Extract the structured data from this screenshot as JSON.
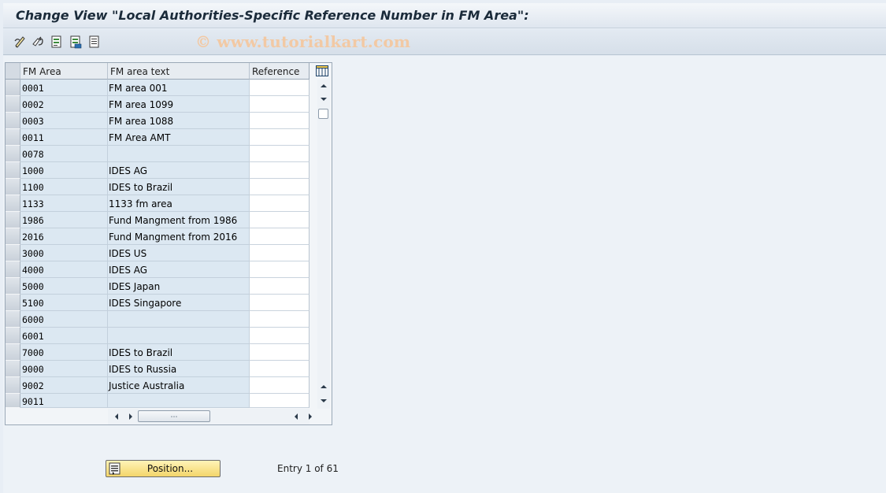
{
  "window": {
    "title": "Change View \"Local Authorities-Specific Reference Number in FM Area\":"
  },
  "toolbar": {
    "watermark": "© www.tutorialkart.com",
    "icons": [
      "display-change-icon",
      "undo-changes-icon",
      "new-entries-icon",
      "copy-as-icon",
      "delete-icon"
    ]
  },
  "table": {
    "columns": [
      "FM Area",
      "FM area text",
      "Reference"
    ],
    "rows": [
      {
        "fm_area": "0001",
        "text": "FM area 001",
        "reference": ""
      },
      {
        "fm_area": "0002",
        "text": "FM area 1099",
        "reference": ""
      },
      {
        "fm_area": "0003",
        "text": "FM area 1088",
        "reference": ""
      },
      {
        "fm_area": "0011",
        "text": "FM Area AMT",
        "reference": ""
      },
      {
        "fm_area": "0078",
        "text": "",
        "reference": ""
      },
      {
        "fm_area": "1000",
        "text": "IDES AG",
        "reference": ""
      },
      {
        "fm_area": "1100",
        "text": "IDES to Brazil",
        "reference": ""
      },
      {
        "fm_area": "1133",
        "text": "1133 fm area",
        "reference": ""
      },
      {
        "fm_area": "1986",
        "text": "Fund Mangment from 1986",
        "reference": ""
      },
      {
        "fm_area": "2016",
        "text": "Fund Mangment from 2016",
        "reference": ""
      },
      {
        "fm_area": "3000",
        "text": "IDES US",
        "reference": ""
      },
      {
        "fm_area": "4000",
        "text": "IDES AG",
        "reference": ""
      },
      {
        "fm_area": "5000",
        "text": "IDES Japan",
        "reference": ""
      },
      {
        "fm_area": "5100",
        "text": "IDES Singapore",
        "reference": ""
      },
      {
        "fm_area": "6000",
        "text": "",
        "reference": ""
      },
      {
        "fm_area": "6001",
        "text": "",
        "reference": ""
      },
      {
        "fm_area": "7000",
        "text": "IDES to Brazil",
        "reference": ""
      },
      {
        "fm_area": "9000",
        "text": "IDES to Russia",
        "reference": ""
      },
      {
        "fm_area": "9002",
        "text": "Justice Australia",
        "reference": ""
      },
      {
        "fm_area": "9011",
        "text": "",
        "reference": ""
      }
    ]
  },
  "footer": {
    "position_button": "Position...",
    "entry_text": "Entry 1 of 61"
  },
  "colors": {
    "cell_bg": "#dce8f2",
    "button_bg": "#f3d56a"
  }
}
